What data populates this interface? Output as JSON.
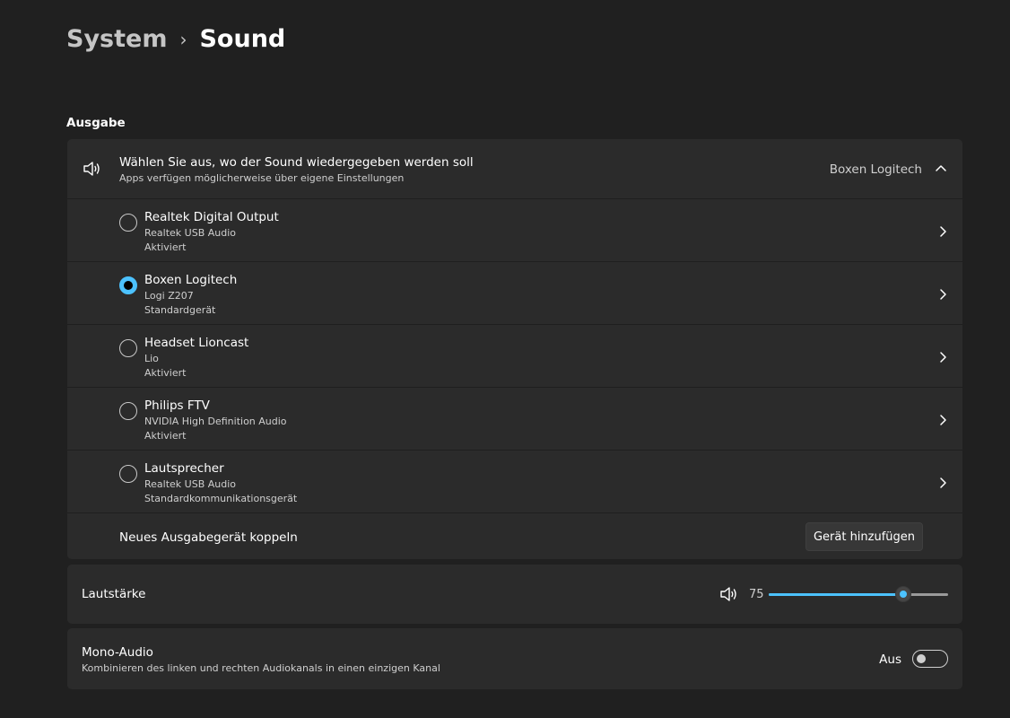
{
  "breadcrumb": {
    "parent": "System",
    "separator": "›",
    "current": "Sound"
  },
  "output": {
    "section_label": "Ausgabe",
    "header": {
      "title": "Wählen Sie aus, wo der Sound wiedergegeben werden soll",
      "subtitle": "Apps verfügen möglicherweise über eigene Einstellungen",
      "selected_value": "Boxen Logitech",
      "icon": "speaker-icon",
      "expanded": true
    },
    "devices": [
      {
        "name": "Realtek Digital Output",
        "sub": "Realtek USB Audio",
        "status": "Aktiviert",
        "selected": false
      },
      {
        "name": "Boxen Logitech",
        "sub": "Logi Z207",
        "status": "Standardgerät",
        "selected": true
      },
      {
        "name": "Headset Lioncast",
        "sub": "Lio",
        "status": "Aktiviert",
        "selected": false
      },
      {
        "name": "Philips FTV",
        "sub": "NVIDIA High Definition Audio",
        "status": "Aktiviert",
        "selected": false
      },
      {
        "name": "Lautsprecher",
        "sub": "Realtek USB Audio",
        "status": "Standardkommunikationsgerät",
        "selected": false
      }
    ],
    "pair": {
      "label": "Neues Ausgabegerät koppeln",
      "button_label": "Gerät hinzufügen"
    }
  },
  "volume": {
    "label": "Lautstärke",
    "value": "75",
    "level_percent": 75,
    "icon": "speaker-icon"
  },
  "mono_audio": {
    "title": "Mono-Audio",
    "subtitle": "Kombinieren des linken und rechten Audiokanals in einen einzigen Kanal",
    "toggle_label": "Aus",
    "enabled": false
  },
  "colors": {
    "accent": "#4cc2ff",
    "background": "#202020",
    "card": "#2b2b2b"
  }
}
